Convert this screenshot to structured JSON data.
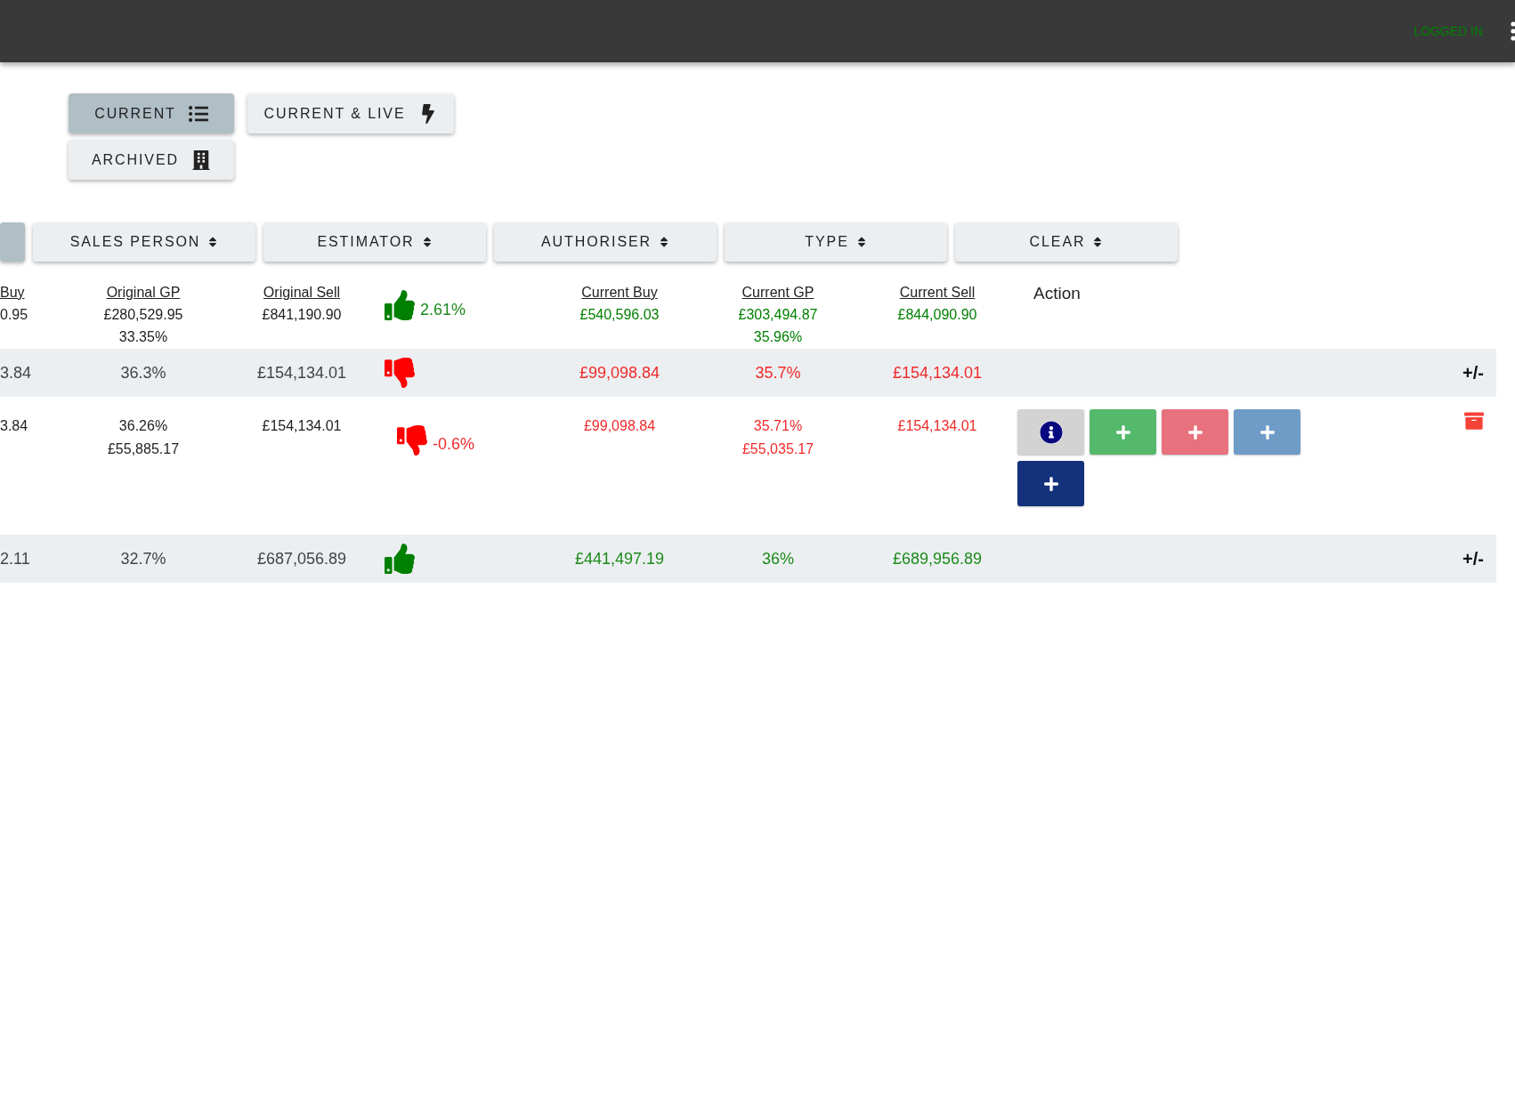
{
  "top_bar": {
    "status": "LOGGED IN"
  },
  "tabs": [
    {
      "label": "CURRENT",
      "selected": true
    },
    {
      "label": "CURRENT & LIVE",
      "selected": false
    },
    {
      "label": "ARCHIVED",
      "selected": false
    }
  ],
  "sort_buttons": [
    {
      "selected": true
    },
    {
      "label": "SALES PERSON",
      "selected": false
    },
    {
      "label": "ESTIMATOR",
      "selected": false
    },
    {
      "label": "AUTHORISER",
      "selected": false
    },
    {
      "label": "TYPE",
      "selected": false
    },
    {
      "label": "CLEAR",
      "selected": false
    }
  ],
  "summary": {
    "original": [
      {
        "heading": "Buy",
        "lines": [
          "0.95"
        ]
      },
      {
        "heading": "Original GP",
        "lines": [
          "£280,529.95",
          "33.35%"
        ]
      },
      {
        "heading": "Original Sell",
        "lines": [
          "£841,190.90"
        ]
      }
    ],
    "up": true,
    "trend_text": "2.61%",
    "positive": true,
    "current": [
      {
        "heading": "Current Buy",
        "lines": [
          "£540,596.03"
        ]
      },
      {
        "heading": "Current GP",
        "lines": [
          "£303,494.87",
          "35.96%"
        ]
      },
      {
        "heading": "Current Sell",
        "lines": [
          "£844,090.90"
        ]
      }
    ],
    "action_heading": "Action"
  },
  "rows": [
    {
      "kind": "group",
      "original": [
        [
          "3.84"
        ],
        [
          "36.3%"
        ],
        [
          "£154,134.01"
        ]
      ],
      "up": false,
      "positive": false,
      "current": [
        [
          "£99,098.84"
        ],
        [
          "35.7%"
        ],
        [
          "£154,134.01"
        ]
      ],
      "toggle": "+/-"
    },
    {
      "kind": "detail",
      "original": [
        [
          "3.84"
        ],
        [
          "36.26%",
          "£55,885.17"
        ],
        [
          "£154,134.01"
        ]
      ],
      "up": false,
      "trend_text": "-0.6%",
      "positive": false,
      "current": [
        [
          "£99,098.84"
        ],
        [
          "35.71%",
          "£55,035.17"
        ],
        [
          "£154,134.01"
        ]
      ],
      "actions": [
        {
          "kind": "info",
          "color": "#d3d3d3"
        },
        {
          "kind": "add",
          "color": "#55b96b"
        },
        {
          "kind": "add",
          "color": "#e8717e"
        },
        {
          "kind": "add",
          "color": "#6f9cc7"
        },
        {
          "kind": "add",
          "color": "#14317c"
        }
      ],
      "archive": true
    },
    {
      "kind": "group",
      "original": [
        [
          "2.11"
        ],
        [
          "32.7%"
        ],
        [
          "£687,056.89"
        ]
      ],
      "up": true,
      "positive": true,
      "current": [
        [
          "£441,497.19"
        ],
        [
          "36%"
        ],
        [
          "£689,956.89"
        ]
      ],
      "toggle": "+/-"
    }
  ]
}
